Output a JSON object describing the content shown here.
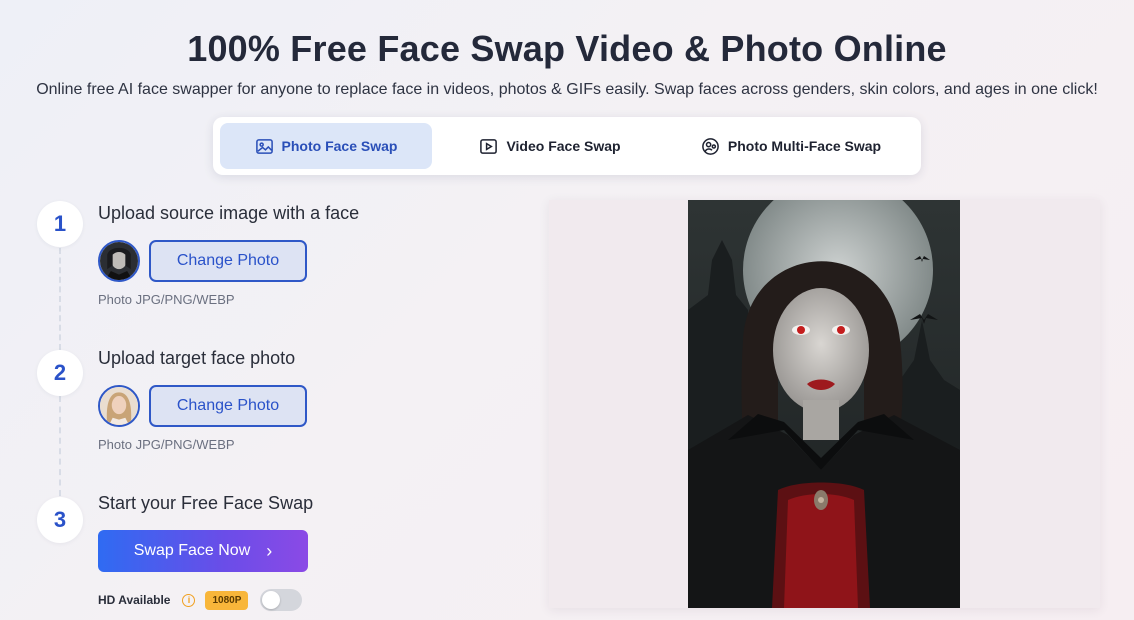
{
  "header": {
    "title": "100% Free Face Swap Video & Photo Online",
    "subtitle": "Online free AI face swapper for anyone to replace face in videos, photos & GIFs easily. Swap faces across genders, skin colors, and ages in one click!"
  },
  "tabs": [
    {
      "label": "Photo Face Swap",
      "icon": "image-icon",
      "active": true
    },
    {
      "label": "Video Face Swap",
      "icon": "play-icon",
      "active": false
    },
    {
      "label": "Photo Multi-Face Swap",
      "icon": "multi-face-icon",
      "active": false
    }
  ],
  "steps": [
    {
      "number": "1",
      "heading": "Upload source image with a face",
      "button_label": "Change Photo",
      "format_note": "Photo JPG/PNG/WEBP"
    },
    {
      "number": "2",
      "heading": "Upload target face photo",
      "button_label": "Change Photo",
      "format_note": "Photo JPG/PNG/WEBP"
    },
    {
      "number": "3",
      "heading": "Start your Free Face Swap",
      "button_label": "Swap Face Now"
    }
  ],
  "hd": {
    "label": "HD Available",
    "badge": "1080P",
    "enabled": false
  },
  "colors": {
    "accent": "#2f58c7",
    "active_tab_bg": "#dce6f8",
    "gradient_start": "#2f6bf2",
    "gradient_end": "#8b4ae6",
    "badge": "#f8b63a"
  }
}
